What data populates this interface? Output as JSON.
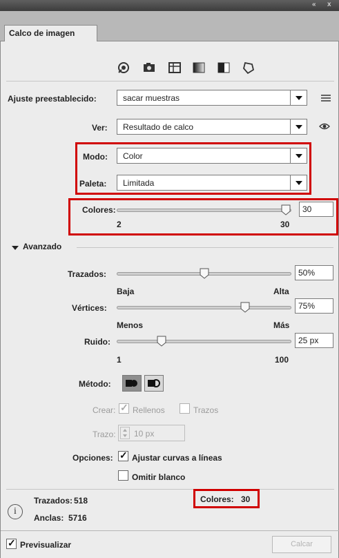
{
  "panel": {
    "tab_label": "Calco de imagen",
    "collapse_glyph": "«",
    "close_glyph": "x"
  },
  "toolbar": {
    "icons": [
      "auto-color-icon",
      "camera-icon",
      "grid-icon",
      "grayscale-icon",
      "black-white-icon",
      "outline-icon"
    ]
  },
  "preset": {
    "label": "Ajuste preestablecido:",
    "value": "sacar muestras"
  },
  "view": {
    "label": "Ver:",
    "value": "Resultado de calco"
  },
  "mode": {
    "label": "Modo:",
    "value": "Color"
  },
  "palette": {
    "label": "Paleta:",
    "value": "Limitada"
  },
  "colors": {
    "label": "Colores:",
    "value": "30",
    "min": "2",
    "max": "30",
    "level": 1.0
  },
  "advanced": {
    "label": "Avanzado"
  },
  "paths": {
    "label": "Trazados:",
    "value": "50%",
    "min_label": "Baja",
    "max_label": "Alta",
    "level": 0.5
  },
  "corners": {
    "label": "Vértices:",
    "value": "75%",
    "min_label": "Menos",
    "max_label": "Más",
    "level": 0.75
  },
  "noise": {
    "label": "Ruido:",
    "value": "25 px",
    "min": "1",
    "max": "100",
    "level": 0.24
  },
  "method": {
    "label": "Método:"
  },
  "create": {
    "label": "Crear:",
    "fills_label": "Rellenos",
    "strokes_label": "Trazos"
  },
  "stroke": {
    "label": "Trazo:",
    "value": "10 px"
  },
  "options": {
    "label": "Opciones:",
    "snap_curves_label": "Ajustar curvas a líneas",
    "ignore_white_label": "Omitir blanco"
  },
  "stats": {
    "paths_label": "Trazados:",
    "paths_value": "518",
    "anchors_label": "Anclas:",
    "anchors_value": "5716",
    "colors_label": "Colores:",
    "colors_value": "30"
  },
  "footer": {
    "preview_label": "Previsualizar",
    "trace_button": "Calcar"
  },
  "colors_ui": {
    "highlight": "#d00000"
  }
}
